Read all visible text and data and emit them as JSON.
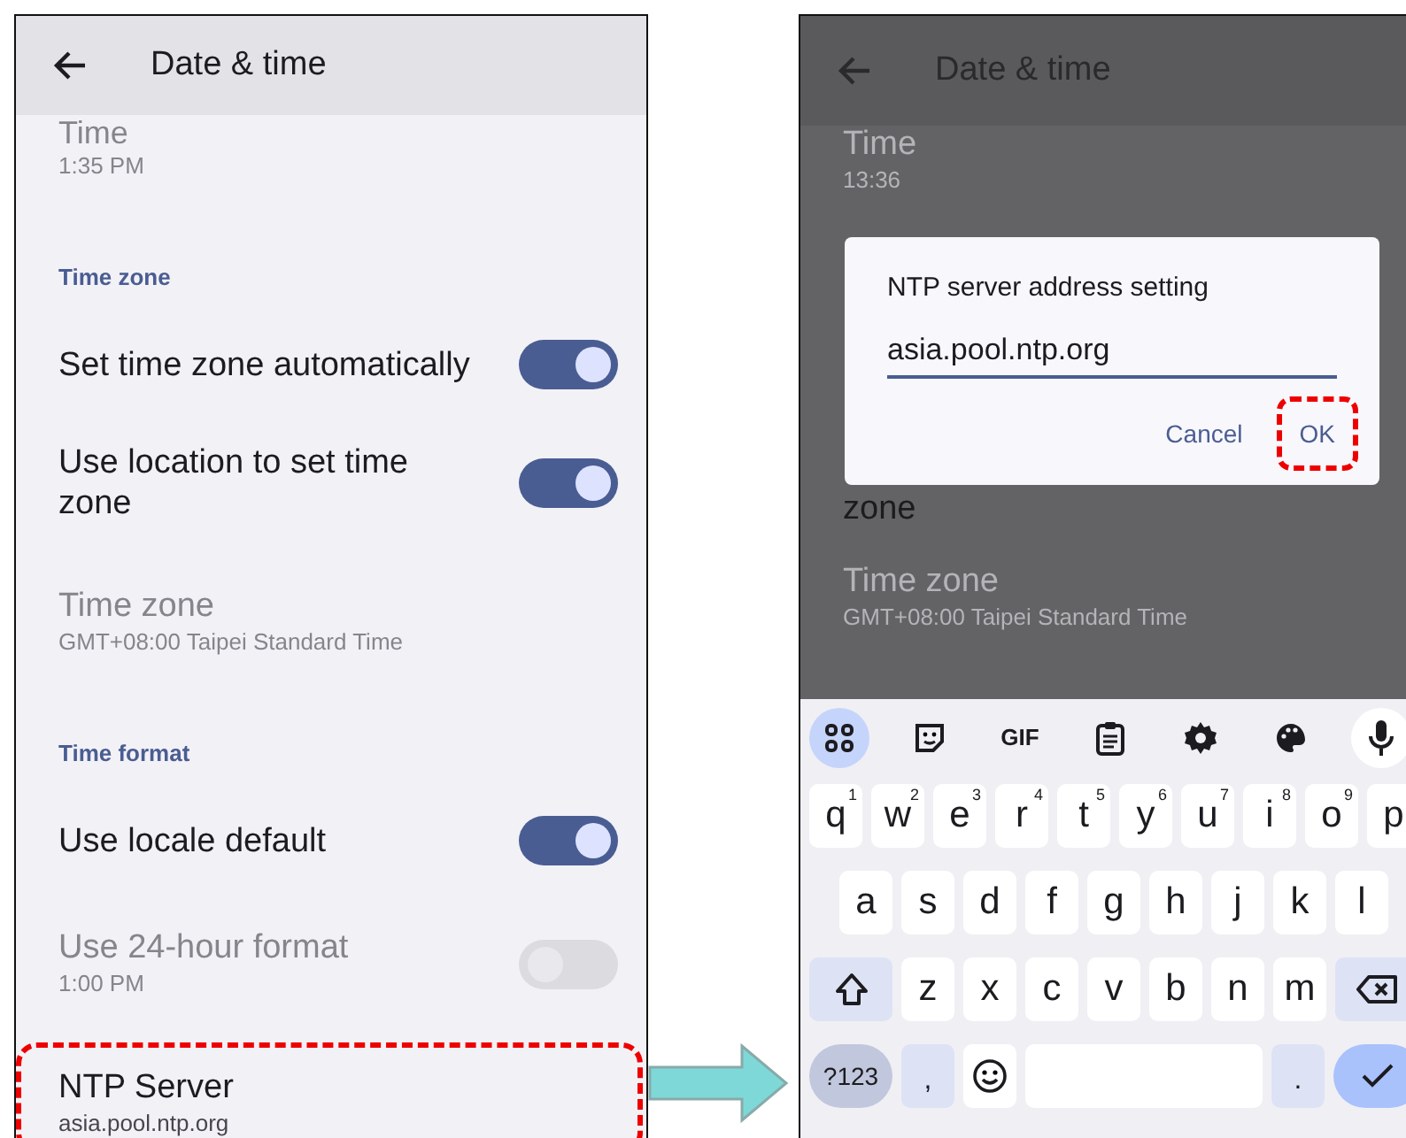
{
  "left_screen": {
    "app_bar": {
      "title": "Date & time"
    },
    "items": [
      {
        "kind": "setting",
        "title": "Time",
        "summary": "1:35 PM",
        "disabled": true,
        "highlighted": false
      },
      {
        "kind": "header",
        "title": "Time zone"
      },
      {
        "kind": "switch",
        "title": "Set time zone automatically",
        "on": true,
        "disabled": false
      },
      {
        "kind": "switch",
        "title": "Use location to set time zone",
        "on": true,
        "disabled": false
      },
      {
        "kind": "setting",
        "title": "Time zone",
        "summary": "GMT+08:00 Taipei Standard Time",
        "disabled": true,
        "highlighted": false
      },
      {
        "kind": "header",
        "title": "Time format"
      },
      {
        "kind": "switch",
        "title": "Use locale default",
        "on": true,
        "disabled": false
      },
      {
        "kind": "switch",
        "title": "Use 24-hour format",
        "summary": "1:00 PM",
        "on": false,
        "disabled": true
      },
      {
        "kind": "setting",
        "title": "NTP Server",
        "summary": "asia.pool.ntp.org",
        "disabled": false,
        "highlighted": true
      }
    ]
  },
  "right_screen": {
    "app_bar": {
      "title": "Date & time"
    },
    "items": [
      {
        "kind": "setting",
        "title": "Time",
        "summary": "13:36",
        "disabled": true,
        "highlighted": false
      },
      {
        "kind": "fragment",
        "title": "zone"
      },
      {
        "kind": "setting",
        "title": "Time zone",
        "summary": "GMT+08:00 Taipei Standard Time",
        "disabled": true,
        "highlighted": false
      }
    ],
    "dialog": {
      "title": "NTP server address setting",
      "value": "asia.pool.ntp.org",
      "buttons": [
        {
          "label": "Cancel",
          "highlighted": false
        },
        {
          "label": "OK",
          "highlighted": true
        }
      ]
    },
    "keyboard": {
      "gif_label": "GIF",
      "rows": [
        [
          {
            "kind": "char",
            "label": "q",
            "hint": "1"
          },
          {
            "kind": "char",
            "label": "w",
            "hint": "2"
          },
          {
            "kind": "char",
            "label": "e",
            "hint": "3"
          },
          {
            "kind": "char",
            "label": "r",
            "hint": "4"
          },
          {
            "kind": "char",
            "label": "t",
            "hint": "5"
          },
          {
            "kind": "char",
            "label": "y",
            "hint": "6"
          },
          {
            "kind": "char",
            "label": "u",
            "hint": "7"
          },
          {
            "kind": "char",
            "label": "i",
            "hint": "8"
          },
          {
            "kind": "char",
            "label": "o",
            "hint": "9"
          },
          {
            "kind": "char",
            "label": "p"
          }
        ],
        [
          {
            "kind": "char",
            "label": "a"
          },
          {
            "kind": "char",
            "label": "s"
          },
          {
            "kind": "char",
            "label": "d"
          },
          {
            "kind": "char",
            "label": "f"
          },
          {
            "kind": "char",
            "label": "g"
          },
          {
            "kind": "char",
            "label": "h"
          },
          {
            "kind": "char",
            "label": "j"
          },
          {
            "kind": "char",
            "label": "k"
          },
          {
            "kind": "char",
            "label": "l"
          }
        ],
        [
          {
            "kind": "shift"
          },
          {
            "kind": "char",
            "label": "z"
          },
          {
            "kind": "char",
            "label": "x"
          },
          {
            "kind": "char",
            "label": "c"
          },
          {
            "kind": "char",
            "label": "v"
          },
          {
            "kind": "char",
            "label": "b"
          },
          {
            "kind": "char",
            "label": "n"
          },
          {
            "kind": "char",
            "label": "m"
          },
          {
            "kind": "backspace"
          }
        ]
      ],
      "bottom_keys": [
        {
          "kind": "symbols",
          "label": "?123"
        },
        {
          "kind": "punct",
          "label": ","
        },
        {
          "kind": "emoji"
        },
        {
          "kind": "space"
        },
        {
          "kind": "punct",
          "label": "."
        },
        {
          "kind": "enter"
        }
      ]
    }
  }
}
